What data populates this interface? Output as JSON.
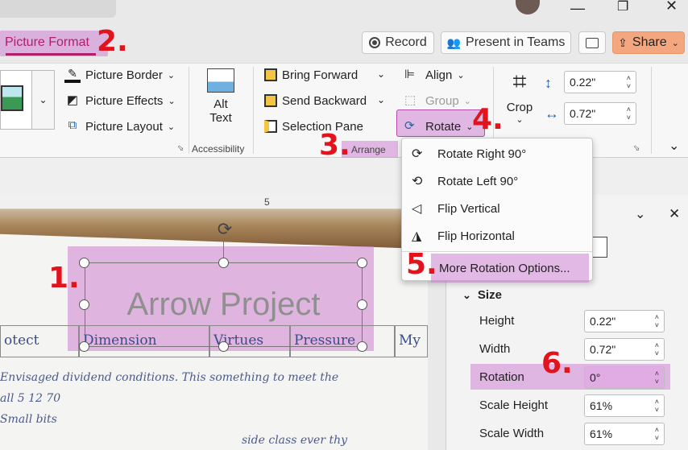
{
  "window": {
    "minimize_icon": "minimize-icon",
    "restore_icon": "restore-icon",
    "close_icon": "close-icon"
  },
  "tab": {
    "label": "Picture Format"
  },
  "header_buttons": {
    "record": "Record",
    "present": "Present in Teams",
    "share": "Share"
  },
  "ribbon": {
    "picture_border": "Picture Border",
    "picture_effects": "Picture Effects",
    "picture_layout": "Picture Layout",
    "alt_text_line1": "Alt",
    "alt_text_line2": "Text",
    "accessibility": "Accessibility",
    "bring_forward": "Bring Forward",
    "send_backward": "Send Backward",
    "selection_pane": "Selection Pane",
    "align": "Align",
    "group": "Group",
    "rotate": "Rotate",
    "arrange": "Arrange",
    "crop": "Crop",
    "height_value": "0.22\"",
    "width_value": "0.72\""
  },
  "rotate_menu": [
    "Rotate Right 90°",
    "Rotate Left 90°",
    "Flip Vertical",
    "Flip Horizontal",
    "More Rotation Options..."
  ],
  "ruler": {
    "mark": "5"
  },
  "slide": {
    "textbox": "Arrow Project",
    "table_cells": [
      "otect",
      "Dimension",
      "Virtues",
      "Pressure",
      "My"
    ],
    "handwriting": [
      "Envisaged dividend conditions. This something to meet the",
      "all 5 12 70",
      "Small bits",
      "side class ever thy"
    ]
  },
  "pane": {
    "section": "Size",
    "rows": [
      {
        "label": "Height",
        "value": "0.22\""
      },
      {
        "label": "Width",
        "value": "0.72\""
      },
      {
        "label": "Rotation",
        "value": "0°"
      },
      {
        "label": "Scale Height",
        "value": "61%"
      },
      {
        "label": "Scale Width",
        "value": "61%"
      }
    ]
  },
  "annotations": [
    "1.",
    "2.",
    "3.",
    "4.",
    "5.",
    "6."
  ]
}
